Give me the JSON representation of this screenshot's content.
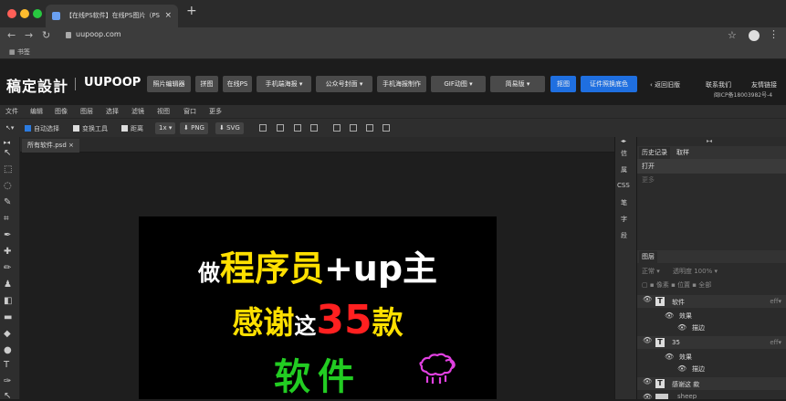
{
  "browser": {
    "tab_title": "【在线PS软件】在线PS图片（PS",
    "tab_close": "×",
    "new_tab": "+",
    "url": "uupoop.com",
    "bookmarks_label": "书签",
    "traffic_colors": [
      "#ff5f57",
      "#febc2e",
      "#28c840"
    ]
  },
  "header": {
    "logo_cn": "稿定設計",
    "logo_sep": "|",
    "logo_en": "UUPOOP",
    "buttons": [
      {
        "label": "照片编辑器"
      },
      {
        "label": "拼图"
      },
      {
        "label": "在线PS"
      },
      {
        "label": "手机端海报 ▾"
      },
      {
        "label": "公众号封面 ▾"
      },
      {
        "label": "手机海报制作"
      },
      {
        "label": "GIF动图 ▾"
      },
      {
        "label": "简易版 ▾"
      },
      {
        "label": "抠图"
      },
      {
        "label": "证件照换底色"
      }
    ],
    "back_old": "‹ 返回旧版",
    "contact": "联系我们",
    "friends": "友情链接",
    "icp": "闽ICP备18003982号-4",
    "accent": "#1f6fe0"
  },
  "menu": [
    "文件",
    "编辑",
    "图像",
    "图层",
    "选择",
    "滤镜",
    "视图",
    "窗口",
    "更多"
  ],
  "options": {
    "auto_select": "自动选择",
    "transform": "变换工具",
    "distance": "距离",
    "zoom": "1x ▾",
    "png": "PNG",
    "svg": "SVG"
  },
  "document": {
    "tab_name": "所有软件.psd",
    "tab_close": "×"
  },
  "artwork": {
    "line1_a": "做",
    "line1_b": "程序员",
    "line1_c": "+up",
    "line1_d": "主",
    "line2_a": "感谢",
    "line2_b": "这",
    "line2_c": "35",
    "line2_d": "款",
    "line3": "软件"
  },
  "icon_column": [
    "信",
    "属",
    "CSS",
    "笔",
    "字",
    "段"
  ],
  "panels": {
    "history_tab": "历史记录",
    "swatch_tab": "取样",
    "history_open": "打开",
    "history_more": "更多",
    "layers_tab": "图层",
    "blend": "正常",
    "opacity_label": "透明度",
    "opacity": "100%",
    "lock_pixel": "像素",
    "lock_pos": "位置",
    "lock_all": "全部",
    "layers": [
      {
        "name": "软件",
        "type": "T"
      },
      {
        "name": "效果",
        "type": "sub"
      },
      {
        "name": "描边",
        "type": "sub2"
      },
      {
        "name": "35",
        "type": "T"
      },
      {
        "name": "效果",
        "type": "sub"
      },
      {
        "name": "描边",
        "type": "sub2"
      },
      {
        "name": "感谢这 款",
        "type": "T"
      },
      {
        "name": "sheep",
        "type": "img"
      }
    ],
    "fx": "eff"
  }
}
